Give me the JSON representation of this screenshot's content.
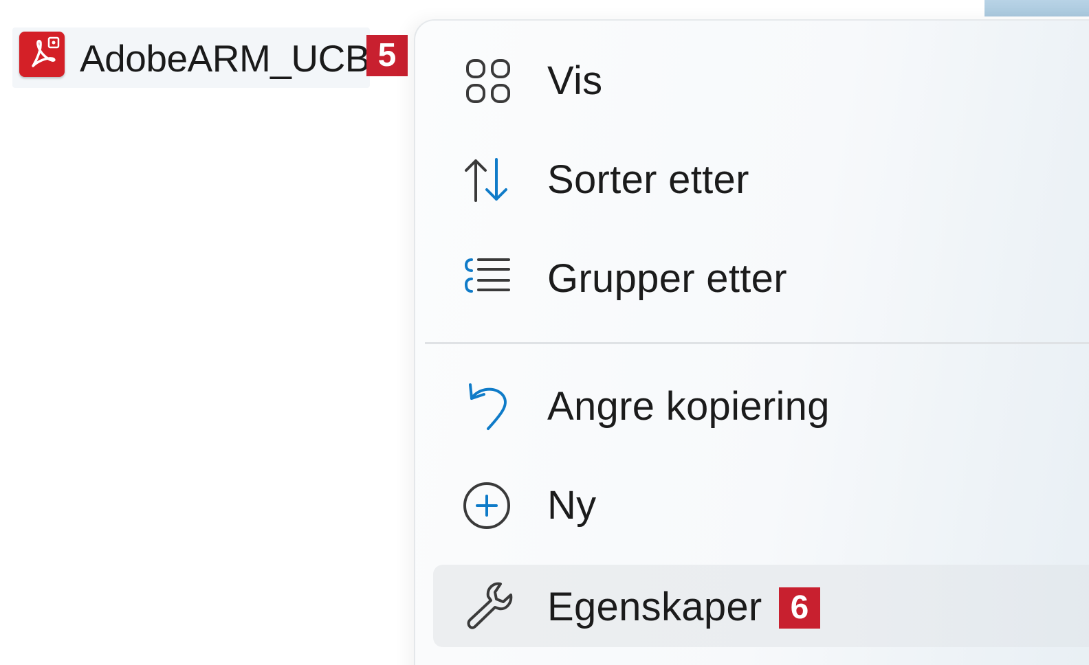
{
  "desktop": {
    "file_name": "AdobeARM_UCB",
    "file_icon": "adobe-acrobat-pdf-icon",
    "badge": "5"
  },
  "context_menu": {
    "items": [
      {
        "label": "Vis",
        "icon": "grid-view-icon"
      },
      {
        "label": "Sorter etter",
        "icon": "sort-arrows-icon"
      },
      {
        "label": "Grupper etter",
        "icon": "group-list-icon"
      },
      {
        "label": "Angre kopiering",
        "icon": "undo-icon"
      },
      {
        "label": "Ny",
        "icon": "add-circle-icon"
      },
      {
        "label": "Egenskaper",
        "icon": "wrench-icon",
        "badge": "6"
      }
    ]
  },
  "colors": {
    "accent_blue": "#0f7bc8",
    "badge_red": "#c8202f",
    "icon_dark": "#3a3a3a",
    "adobe_red": "#d42027"
  }
}
